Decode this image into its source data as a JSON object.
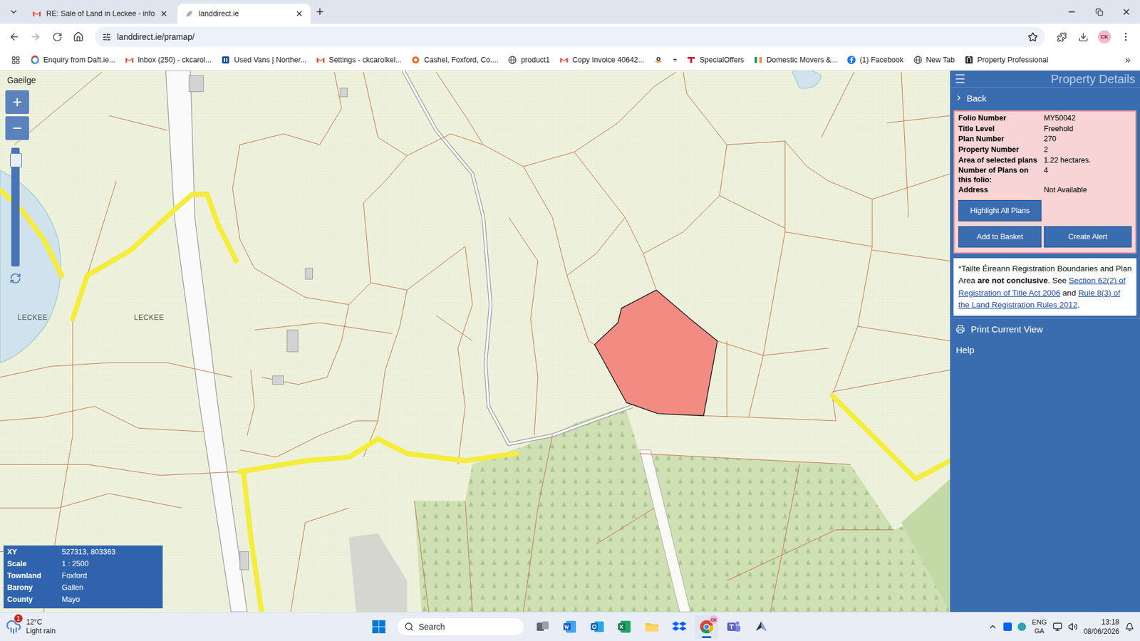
{
  "browser": {
    "tabs": [
      {
        "label": "RE: Sale of Land in Leckee - info",
        "selected": false,
        "kind": "gmail"
      },
      {
        "label": "landdirect.ie",
        "selected": true,
        "kind": "leaf"
      }
    ],
    "address": "landdirect.ie/pramap/",
    "profile": "CK",
    "bookmarks": [
      {
        "label": "Enquiry from Daft.ie...",
        "kind": "google"
      },
      {
        "label": "Inbox (250) - ckcarol...",
        "kind": "gmail"
      },
      {
        "label": "Used Vans | Norther...",
        "kind": "vans"
      },
      {
        "label": "Settings - ckcarolkel...",
        "kind": "gmail"
      },
      {
        "label": "Cashel, Foxford, Co....",
        "kind": "cashel"
      },
      {
        "label": "product1",
        "kind": "globe"
      },
      {
        "label": "Copy Invoice 40642...",
        "kind": "gmail"
      },
      {
        "kind": "amazon"
      },
      {
        "label": "+",
        "kind": "none"
      },
      {
        "label": "SpecialOffers",
        "kind": "tesco"
      },
      {
        "label": "Domestic Movers &...",
        "kind": "flag"
      },
      {
        "label": "(1) Facebook",
        "kind": "facebook"
      },
      {
        "label": "New Tab",
        "kind": "globe"
      },
      {
        "label": "Property Professional",
        "kind": "pp"
      }
    ],
    "bookmarks_more": "»"
  },
  "map": {
    "language": "Gaeilge",
    "zoom_in": "+",
    "zoom_out": "−",
    "zoom_level": 0.95,
    "place_labels": [
      "LECKEE",
      "LECKEE"
    ],
    "selected_plot_highlighted": true,
    "info": [
      {
        "label": "XY",
        "value": "527313, 803363"
      },
      {
        "label": "Scale",
        "value": "1 : 2500"
      },
      {
        "label": "Townland",
        "value": "Foxford"
      },
      {
        "label": "Barony",
        "value": "Gallen"
      },
      {
        "label": "County",
        "value": "Mayo"
      }
    ]
  },
  "panel": {
    "menu": "☰",
    "title": "Property Details",
    "back": "Back",
    "details": [
      {
        "label": "Folio Number",
        "value": "MY50042"
      },
      {
        "label": "Title Level",
        "value": "Freehold"
      },
      {
        "label": "Plan Number",
        "value": "270"
      },
      {
        "label": "Property Number",
        "value": "2"
      },
      {
        "label": "Area of selected plans",
        "value": "1.22 hectares."
      },
      {
        "label": "Number of Plans on this folio:",
        "value": "4"
      },
      {
        "label": "Address",
        "value": "Not Available"
      }
    ],
    "highlight_button": "Highlight All Plans",
    "action_buttons": [
      "Add to Basket",
      "Create Alert"
    ],
    "notice": [
      {
        "text": "*Tailte Éireann Registration Boundaries and Plan Area ",
        "kind": "plain"
      },
      {
        "text": "are not conclusive",
        "kind": "bold"
      },
      {
        "text": ". See ",
        "kind": "plain"
      },
      {
        "text": "Section 62(2) of Registration of Title Act 2006",
        "kind": "link"
      },
      {
        "text": " and ",
        "kind": "plain"
      },
      {
        "text": "Rule 8(3) of the Land Registration Rules 2012",
        "kind": "link"
      },
      {
        "text": ".",
        "kind": "plain"
      }
    ],
    "menu_items": [
      {
        "label": "Print Current View",
        "kind": "print"
      },
      {
        "label": "Help",
        "kind": "plain"
      }
    ]
  },
  "taskbar": {
    "weather": {
      "temp": "12°C",
      "desc": "Light rain",
      "badge": "1"
    },
    "search": "Search",
    "apps": [
      {
        "kind": "taskview",
        "active": false
      },
      {
        "kind": "word",
        "active": false
      },
      {
        "kind": "outlook",
        "active": false
      },
      {
        "kind": "excel",
        "active": false
      },
      {
        "kind": "explorer",
        "active": false
      },
      {
        "kind": "dropbox",
        "active": false
      },
      {
        "kind": "chrome",
        "active": true,
        "badge": "CK"
      },
      {
        "kind": "teams",
        "active": false
      },
      {
        "kind": "other",
        "active": false
      }
    ],
    "language": [
      "ENG",
      "GA"
    ],
    "time": "13:18",
    "date": "08/06/2026"
  }
}
